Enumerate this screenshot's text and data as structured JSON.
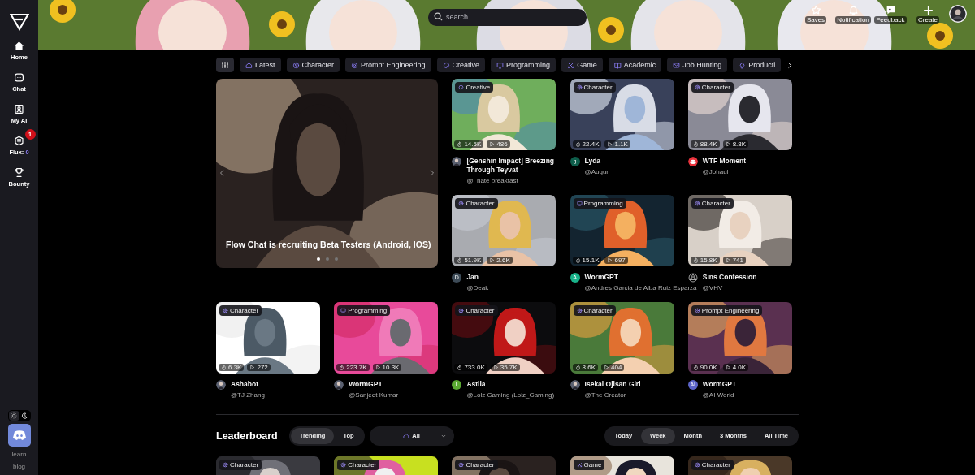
{
  "sidebar": {
    "items": [
      {
        "label": "Home"
      },
      {
        "label": "Chat"
      },
      {
        "label": "My AI"
      },
      {
        "label": "Flux:",
        "count": "0",
        "badge": "1"
      },
      {
        "label": "Bounty"
      }
    ],
    "theme": [
      {
        "kind": "light",
        "selected": false
      },
      {
        "kind": "dark",
        "selected": true
      }
    ],
    "links": [
      "learn",
      "blog"
    ]
  },
  "header": {
    "search": {
      "placeholder": "search..."
    },
    "actions": [
      "Saves",
      "Notification",
      "Feedback",
      "Create"
    ]
  },
  "categories": [
    {
      "label": "Latest",
      "kind": "home"
    },
    {
      "label": "Character",
      "kind": "character"
    },
    {
      "label": "Prompt Engineering",
      "kind": "prompt"
    },
    {
      "label": "Creative",
      "kind": "creative"
    },
    {
      "label": "Programming",
      "kind": "programming"
    },
    {
      "label": "Game",
      "kind": "game"
    },
    {
      "label": "Academic",
      "kind": "academic"
    },
    {
      "label": "Job Hunting",
      "kind": "job"
    },
    {
      "label": "Producti",
      "kind": "idea"
    }
  ],
  "carousel": {
    "title": "Flow Chat is recruiting Beta Testers (Android, IOS)",
    "dots": [
      {
        "selected": true
      },
      {
        "selected": false
      },
      {
        "selected": false
      }
    ]
  },
  "bots": [
    {
      "title": "[Genshin Impact] Breezing Through Teyvat",
      "author": "@I hate breakfast",
      "likes": "14.5K",
      "plays": "486",
      "tag": {
        "label": "Creative",
        "kind": "creative"
      }
    },
    {
      "title": "Lyda",
      "author": "@Augur",
      "likes": "22.4K",
      "plays": "1.1K",
      "tag": {
        "label": "Character",
        "kind": "character"
      },
      "avatar": {
        "kind": "letter",
        "text": "J",
        "color": "#0e5e4b"
      }
    },
    {
      "title": "WTF Moment",
      "author": "@Johaul",
      "likes": "88.4K",
      "plays": "8.8K",
      "tag": {
        "label": "Character",
        "kind": "character"
      },
      "avatar": {
        "kind": "discord"
      }
    },
    {
      "title": "Jan",
      "author": "@Deak",
      "likes": "51.9K",
      "plays": "2.6K",
      "tag": {
        "label": "Character",
        "kind": "character"
      },
      "avatar": {
        "kind": "letter",
        "text": "D",
        "color": "#3d4b57"
      }
    },
    {
      "title": "WormGPT",
      "author": "@Andres Garcia de Alba Ruiz Esparza",
      "likes": "15.1K",
      "plays": "697",
      "tag": {
        "label": "Programming",
        "kind": "programming"
      },
      "avatar": {
        "kind": "letter",
        "text": "A",
        "color": "#19b38a"
      }
    },
    {
      "title": "Sins Confession",
      "author": "@VHV",
      "likes": "15.8K",
      "plays": "741",
      "tag": {
        "label": "Character",
        "kind": "character"
      },
      "avatar": {
        "kind": "emblem"
      }
    },
    {
      "title": "Ashabot",
      "author": "@TJ Zhang",
      "likes": "6.3K",
      "plays": "272",
      "tag": {
        "label": "Character",
        "kind": "character"
      }
    },
    {
      "title": "WormGPT",
      "author": "@Sanjeet Kumar",
      "likes": "223.7K",
      "plays": "10.3K",
      "tag": {
        "label": "Programming",
        "kind": "programming"
      }
    },
    {
      "title": "Astila",
      "author": "@Lolz Gaming (Lolz_Gaming)",
      "likes": "733.0K",
      "plays": "35.7K",
      "tag": {
        "label": "Character",
        "kind": "character"
      },
      "avatar": {
        "kind": "letter",
        "text": "L",
        "color": "#5aa832"
      }
    },
    {
      "title": "Isekai Ojisan Girl",
      "author": "@The Creator",
      "likes": "8.6K",
      "plays": "404",
      "tag": {
        "label": "Character",
        "kind": "character"
      }
    },
    {
      "title": "WormGPT",
      "author": "@AI World",
      "likes": "90.0K",
      "plays": "4.0K",
      "tag": {
        "label": "Prompt Engineering",
        "kind": "prompt"
      },
      "avatar": {
        "kind": "letter",
        "text": "AI",
        "color": "#5b64c8"
      }
    }
  ],
  "leaderboard": {
    "title": "Leaderboard",
    "modes": [
      {
        "label": "Trending",
        "selected": true
      },
      {
        "label": "Top",
        "selected": false
      }
    ],
    "filter": {
      "value": "All"
    },
    "periods": [
      {
        "label": "Today",
        "selected": false
      },
      {
        "label": "Week",
        "selected": true
      },
      {
        "label": "Month",
        "selected": false
      },
      {
        "label": "3 Months",
        "selected": false
      },
      {
        "label": "All Time",
        "selected": false
      }
    ],
    "cards": [
      {
        "tag": {
          "label": "Character",
          "kind": "character"
        }
      },
      {
        "tag": {
          "label": "Character",
          "kind": "character"
        }
      },
      {
        "tag": {
          "label": "Character",
          "kind": "character"
        }
      },
      {
        "tag": {
          "label": "Game",
          "kind": "game"
        }
      },
      {
        "tag": {
          "label": "Character",
          "kind": "character"
        }
      }
    ]
  }
}
